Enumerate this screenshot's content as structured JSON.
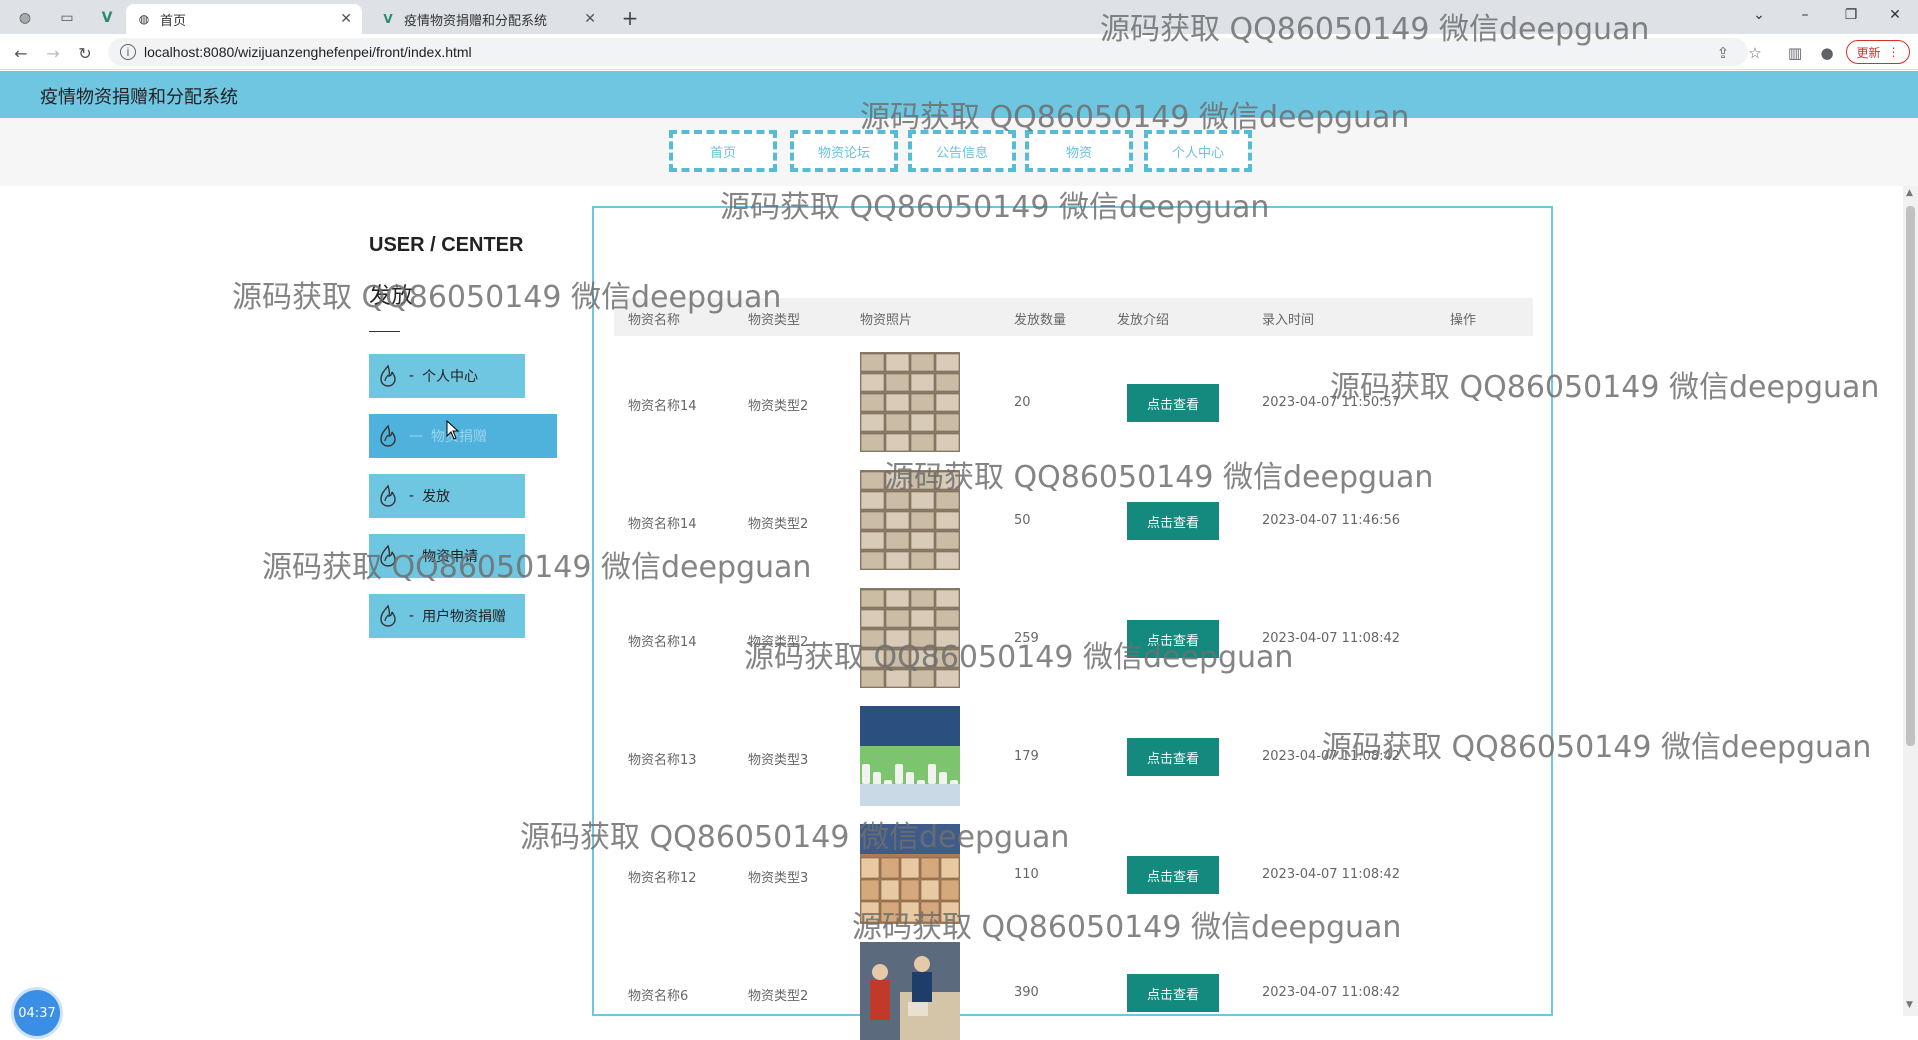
{
  "browser": {
    "active_tab_title": "首页",
    "second_tab_title": "疫情物资捐赠和分配系统",
    "url": "localhost:8080/wizijuanzenghefenpei/front/index.html",
    "update_label": "更新"
  },
  "site": {
    "title": "疫情物资捐赠和分配系统",
    "nav": [
      "首页",
      "物资论坛",
      "公告信息",
      "物资",
      "个人中心"
    ]
  },
  "user_center": {
    "title": "USER / CENTER",
    "subtitle": "发放",
    "menu": [
      {
        "label": "个人中心",
        "active": false
      },
      {
        "label": "物资捐赠",
        "active": true
      },
      {
        "label": "发放",
        "active": false
      },
      {
        "label": "物资申请",
        "active": false
      },
      {
        "label": "用户物资捐赠",
        "active": false
      }
    ],
    "separator": "-",
    "active_separator": "—"
  },
  "table": {
    "headers": [
      "物资名称",
      "物资类型",
      "物资照片",
      "发放数量",
      "发放介绍",
      "录入时间",
      "操作"
    ],
    "button_label": "点击查看",
    "rows": [
      {
        "name": "物资名称14",
        "type": "物资类型2",
        "qty": "20",
        "time": "2023-04-07 11:50:57",
        "photo": "boxes"
      },
      {
        "name": "物资名称14",
        "type": "物资类型2",
        "qty": "50",
        "time": "2023-04-07 11:46:56",
        "photo": "boxes"
      },
      {
        "name": "物资名称14",
        "type": "物资类型2",
        "qty": "259",
        "time": "2023-04-07 11:08:42",
        "photo": "boxes"
      },
      {
        "name": "物资名称13",
        "type": "物资类型3",
        "qty": "179",
        "time": "2023-04-07 11:08:42",
        "photo": "bottles"
      },
      {
        "name": "物资名称12",
        "type": "物资类型3",
        "qty": "110",
        "time": "2023-04-07 11:08:42",
        "photo": "warehouse"
      },
      {
        "name": "物资名称6",
        "type": "物资类型2",
        "qty": "390",
        "time": "2023-04-07 11:08:42",
        "photo": "workers"
      }
    ]
  },
  "timer": "04:37",
  "watermark": "源码获取 QQ86050149 微信deepguan",
  "colors": {
    "header_bg": "#6ec6e0",
    "nav_border": "#54bcd6",
    "button_bg": "#138a7d",
    "menu_active": "#4fb2dc"
  }
}
